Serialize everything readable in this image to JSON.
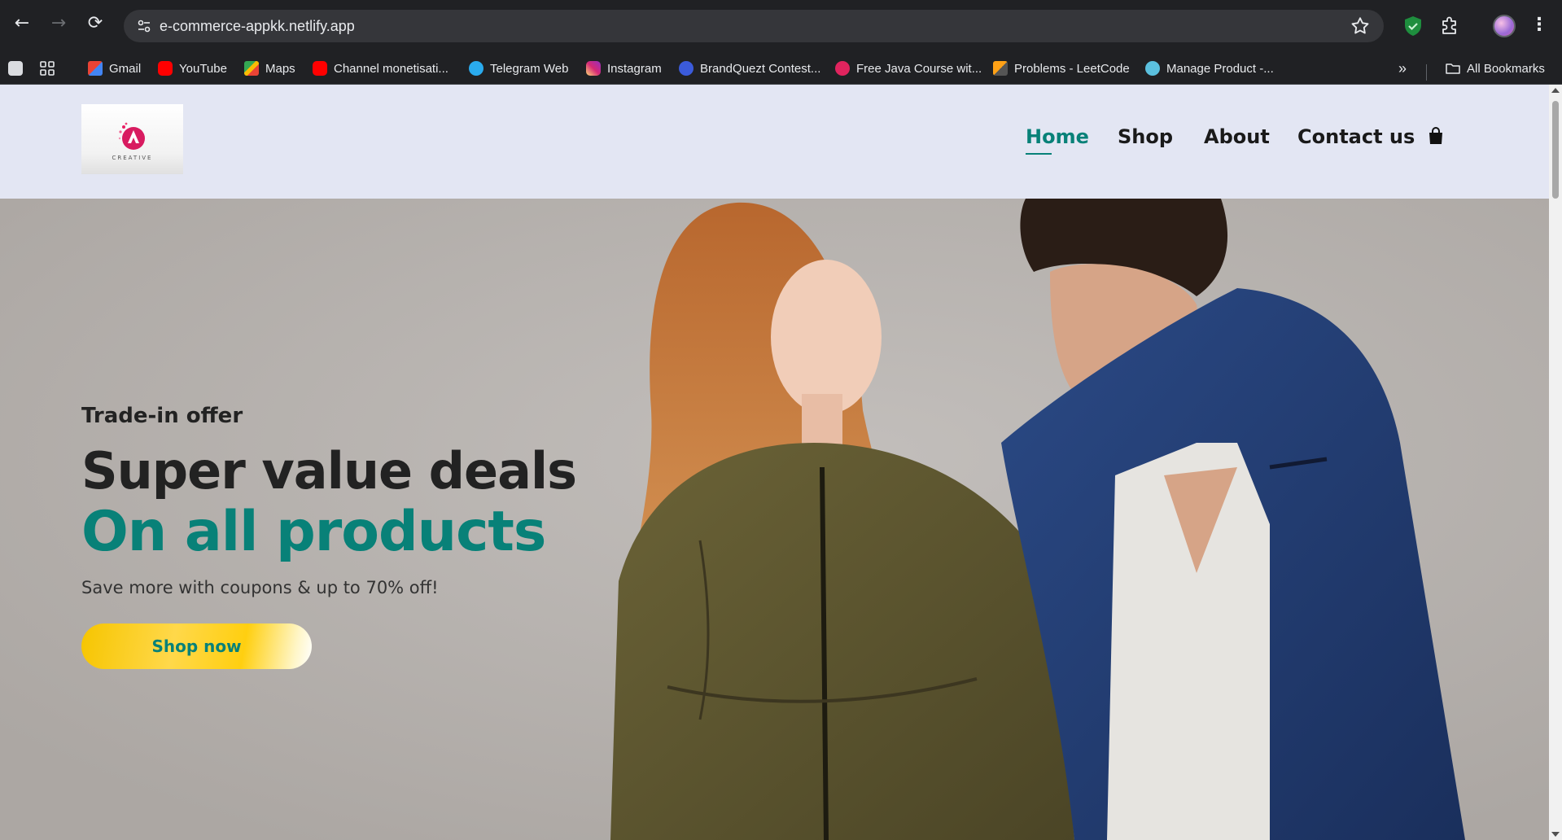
{
  "browser": {
    "url": "e-commerce-appkk.netlify.app",
    "nav": {
      "back": "←",
      "forward": "→",
      "reload": "⟳"
    },
    "menu_glyph": "⋮",
    "bookmarks_overflow": "»",
    "bookmarks": [
      {
        "label": "Gmail",
        "icon": "gmail-icon",
        "color": "#ea4335"
      },
      {
        "label": "YouTube",
        "icon": "youtube-icon",
        "color": "#ff0000"
      },
      {
        "label": "Maps",
        "icon": "maps-icon",
        "color": "#34a853"
      },
      {
        "label": "Channel monetisati...",
        "icon": "youtube-icon",
        "color": "#ff0000"
      },
      {
        "label": "Telegram Web",
        "icon": "telegram-icon",
        "color": "#2aabee"
      },
      {
        "label": "Instagram",
        "icon": "instagram-icon",
        "color": "#e1306c"
      },
      {
        "label": "BrandQuezt Contest...",
        "icon": "brandquezt-icon",
        "color": "#3b5bdb"
      },
      {
        "label": "Free Java Course wit...",
        "icon": "java-course-icon",
        "color": "#e0245e"
      },
      {
        "label": "Problems - LeetCode",
        "icon": "leetcode-icon",
        "color": "#ffa116"
      },
      {
        "label": "Manage Product -...",
        "icon": "manage-product-icon",
        "color": "#5bc0de"
      }
    ],
    "all_bookmarks": "All Bookmarks"
  },
  "site": {
    "logo_text": "CREATIVE",
    "nav": [
      {
        "label": "Home",
        "active": true
      },
      {
        "label": "Shop",
        "active": false
      },
      {
        "label": "About",
        "active": false
      },
      {
        "label": "Contact us",
        "active": false
      }
    ],
    "cart_icon": "shopping-bag-icon"
  },
  "hero": {
    "kicker": "Trade-in offer",
    "title": "Super value deals",
    "highlight": "On all products",
    "subtitle": "Save more with coupons & up to 70% off!",
    "button": "Shop now"
  },
  "colors": {
    "accent": "#088178",
    "header_bg": "#e3e6f3",
    "hero_bg": "#b9b5b1",
    "button_yellow": "#ffd000"
  }
}
